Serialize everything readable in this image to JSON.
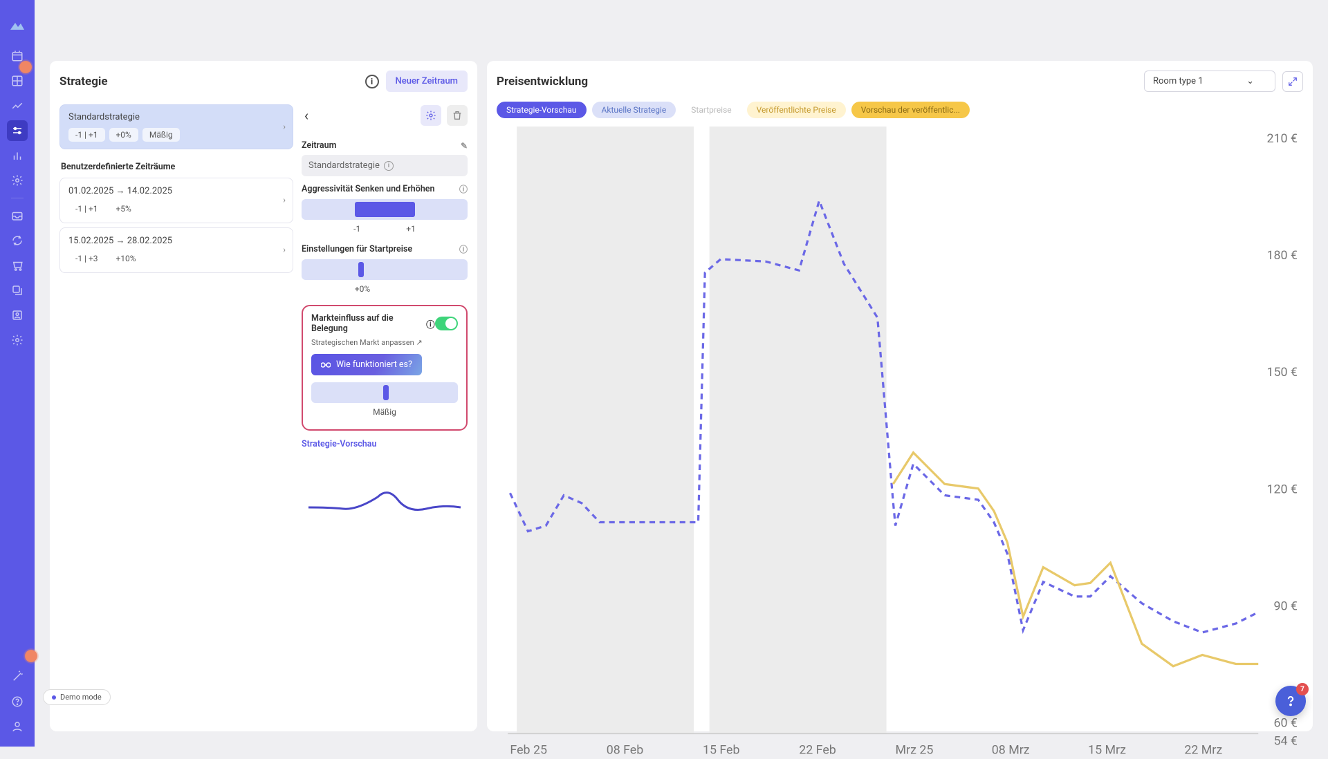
{
  "sidebar": {
    "icons": [
      "calendar",
      "grid",
      "chart",
      "sliders",
      "column-chart",
      "gear",
      "inbox",
      "sync",
      "cart",
      "layers",
      "user",
      "settings",
      "wand",
      "help-circle",
      "user-profile"
    ]
  },
  "left_panel": {
    "title": "Strategie",
    "new_period_btn": "Neuer Zeitraum",
    "standard": {
      "title": "Standardstrategie",
      "aggr_chip": "-1 | +1",
      "pct_chip": "+0%",
      "level_chip": "Mäßig"
    },
    "custom_periods_label": "Benutzerdefinierte Zeiträume",
    "periods": [
      {
        "title": "01.02.2025 → 14.02.2025",
        "aggr_chip": "-1 | +1",
        "pct_chip": "+5%"
      },
      {
        "title": "15.02.2025 → 28.02.2025",
        "aggr_chip": "-1 | +3",
        "pct_chip": "+10%"
      }
    ]
  },
  "detail": {
    "period_label": "Zeitraum",
    "period_value": "Standardstrategie",
    "aggr_label": "Aggressivität Senken und Erhöhen",
    "aggr_low": "-1",
    "aggr_high": "+1",
    "start_label": "Einstellungen für Startpreise",
    "start_pct": "+0%",
    "market_label": "Markteinfluss auf die Belegung",
    "market_sublink": "Strategischen Markt anpassen ↗",
    "how_btn": "Wie funktioniert es?",
    "market_level": "Mäßig",
    "preview_label": "Strategie-Vorschau"
  },
  "right_panel": {
    "title": "Preisentwicklung",
    "room_select": "Room type 1",
    "legend": {
      "preview": "Strategie-Vorschau",
      "current": "Aktuelle Strategie",
      "start": "Startpreise",
      "published": "Veröffentlichte Preise",
      "pub_preview": "Vorschau der veröffentlic..."
    }
  },
  "chart_data": {
    "type": "line",
    "title": "Preisentwicklung",
    "ylabel": "€",
    "ylim": [
      54,
      210
    ],
    "y_ticks": [
      54,
      60,
      90,
      120,
      150,
      180,
      210
    ],
    "x_ticks": [
      "Feb 25",
      "08 Feb",
      "15 Feb",
      "22 Feb",
      "Mrz 25",
      "08 Mrz",
      "15 Mrz",
      "22 Mrz"
    ],
    "series": [
      {
        "name": "Strategie-Vorschau",
        "style": "dashed",
        "color": "#5b58e6",
        "x": [
          "Feb 25",
          "02 Feb",
          "04 Feb",
          "06 Feb",
          "08 Feb",
          "10 Feb",
          "12 Feb",
          "14 Feb",
          "15 Feb",
          "18 Feb",
          "22 Feb",
          "25 Feb",
          "28 Feb",
          "Mrz 25",
          "03 Mrz",
          "05 Mrz",
          "08 Mrz",
          "11 Mrz",
          "15 Mrz",
          "18 Mrz",
          "22 Mrz",
          "26 Mrz"
        ],
        "values": [
          120,
          110,
          112,
          120,
          113,
          112,
          112,
          112,
          178,
          180,
          178,
          190,
          170,
          110,
          120,
          115,
          110,
          95,
          90,
          95,
          85,
          88
        ]
      },
      {
        "name": "Veröffentlichte Preise",
        "style": "solid",
        "color": "#e8c96a",
        "x": [
          "Mrz 25",
          "03 Mrz",
          "05 Mrz",
          "08 Mrz",
          "11 Mrz",
          "15 Mrz",
          "18 Mrz",
          "22 Mrz",
          "26 Mrz"
        ],
        "values": [
          122,
          125,
          120,
          118,
          100,
          98,
          95,
          82,
          80
        ]
      }
    ],
    "shaded_ranges": [
      {
        "from": "01 Feb",
        "to": "14 Feb"
      },
      {
        "from": "15 Feb",
        "to": "28 Feb"
      }
    ]
  },
  "demo_mode": "Demo mode",
  "help_badge": "7"
}
